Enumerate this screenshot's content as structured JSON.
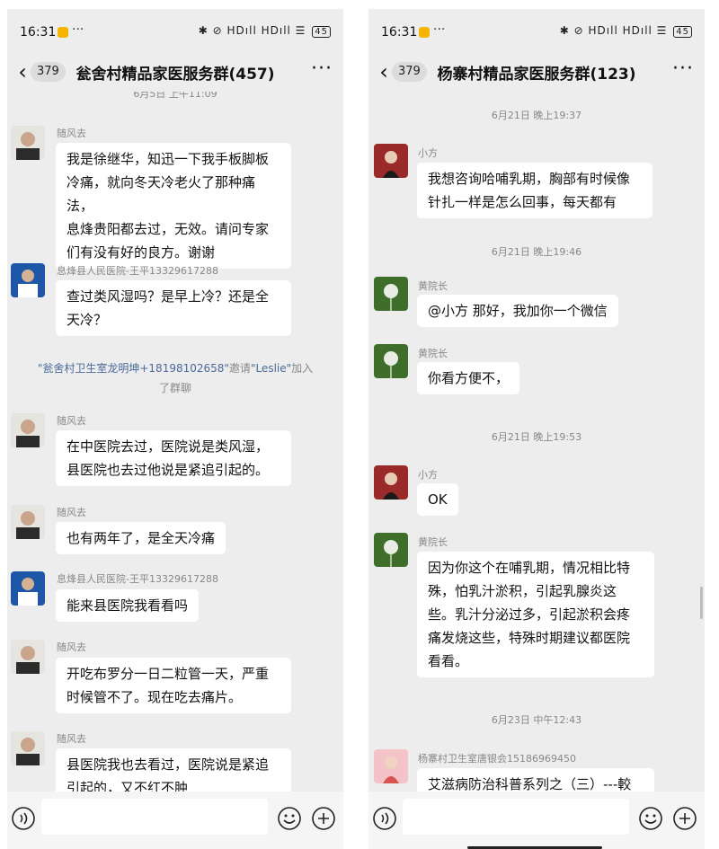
{
  "status_bar": {
    "time": "16:31",
    "dots": "···",
    "indicators": "✱ ⊘ HDıll HDıll ☰",
    "battery": "45"
  },
  "left": {
    "unread": "379",
    "title": "瓮舍村精品家医服务群(457)",
    "top_partial": "6月5日 上午11:09",
    "messages": [
      {
        "sender": "随风去",
        "avatar": "man-dark",
        "lines": [
          "我是徐继华，知迅一下我手板脚板",
          "冷痛，就向冬天冷老火了那种痛法，",
          "息烽贵阳都去过，无效。请问专家",
          "们有没有好的良方。谢谢"
        ]
      },
      {
        "sender": "息烽县人民医院-王平13329617288",
        "avatar": "doctor",
        "lines": [
          "查过类风湿吗？是早上冷？还是全",
          "天冷？"
        ]
      },
      {
        "sender": "随风去",
        "avatar": "man-dark",
        "lines": [
          "在中医院去过，医院说是类风湿，",
          "县医院也去过他说是紧追引起的。"
        ]
      },
      {
        "sender": "随风去",
        "avatar": "man-dark",
        "lines": [
          "也有两年了，是全天冷痛"
        ]
      },
      {
        "sender": "息烽县人民医院-王平13329617288",
        "avatar": "doctor",
        "lines": [
          "能来县医院我看看吗"
        ]
      },
      {
        "sender": "随风去",
        "avatar": "man-dark",
        "lines": [
          "开吃布罗分一日二粒管一天，严重",
          "时候管不了。现在吃去痛片。"
        ]
      },
      {
        "sender": "随风去",
        "avatar": "man-dark",
        "lines": [
          "县医院我也去看过，医院说是紧追",
          "引起的，又不红不肿"
        ]
      }
    ],
    "system": {
      "inviter": "\"瓮舍村卫生室龙明坤+18198102658\"",
      "action": "邀请",
      "invitee": "\"Leslie\"",
      "suffix": "加入",
      "line2": "了群聊"
    }
  },
  "right": {
    "unread": "379",
    "title": "杨寨村精品家医服务群(123)",
    "times": [
      "6月21日 晚上19:37",
      "6月21日 晚上19:46",
      "6月21日 晚上19:53",
      "6月23日 中午12:43"
    ],
    "messages": [
      {
        "sender": "小方",
        "avatar": "woman",
        "lines": [
          "我想咨询哈哺乳期，胸部有时候像",
          "针扎一样是怎么回事，每天都有"
        ]
      },
      {
        "sender": "黄院长",
        "avatar": "dandelion",
        "lines": [
          "@小方  那好，我加你一个微信"
        ]
      },
      {
        "sender": "黄院长",
        "avatar": "dandelion",
        "lines": [
          "你看方便不，"
        ]
      },
      {
        "sender": "小方",
        "avatar": "woman",
        "lines": [
          "OK"
        ]
      },
      {
        "sender": "黄院长",
        "avatar": "dandelion",
        "lines": [
          "因为你这个在哺乳期，情况相比特",
          "殊，怕乳汁淤积，引起乳腺炎这",
          "些。乳汁分泌过多，引起淤积会疼",
          "痛发烧这些，特殊时期建议都医院",
          "看看。"
        ]
      },
      {
        "sender": "杨寨村卫生室唐银会15186969450",
        "avatar": "woman-pink",
        "lines": [
          "艾滋病防治科普系列之（三）---較"
        ]
      }
    ]
  },
  "icons": {
    "back": "chevron-left-icon",
    "more": "more-dots-icon",
    "voice": "voice-icon",
    "emoji": "emoji-icon",
    "plus": "plus-icon"
  },
  "colors": {
    "chat_bg": "#ededed",
    "bubble": "#ffffff",
    "system_link": "#4a6a9a"
  }
}
